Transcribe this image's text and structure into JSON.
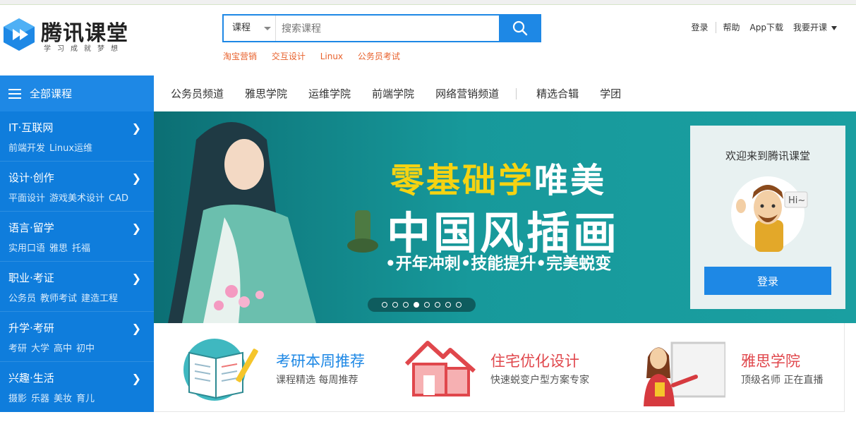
{
  "brand": {
    "name": "腾讯课堂",
    "slogan": "学习成就梦想"
  },
  "search": {
    "category": "课程",
    "placeholder": "搜索课程"
  },
  "hot_keywords": [
    "淘宝营销",
    "交互设计",
    "Linux",
    "公务员考试"
  ],
  "top_links": {
    "login": "登录",
    "help": "帮助",
    "app": "App下载",
    "teach": "我要开课"
  },
  "sidebar": {
    "header": "全部课程",
    "categories": [
      {
        "title": "IT·互联网",
        "subs": [
          "前端开发",
          "Linux运维"
        ]
      },
      {
        "title": "设计·创作",
        "subs": [
          "平面设计",
          "游戏美术设计",
          "CAD"
        ]
      },
      {
        "title": "语言·留学",
        "subs": [
          "实用口语",
          "雅思",
          "托福"
        ]
      },
      {
        "title": "职业·考证",
        "subs": [
          "公务员",
          "教师考试",
          "建造工程"
        ]
      },
      {
        "title": "升学·考研",
        "subs": [
          "考研",
          "大学",
          "高中",
          "初中"
        ]
      },
      {
        "title": "兴趣·生活",
        "subs": [
          "摄影",
          "乐器",
          "美妆",
          "育儿"
        ]
      }
    ]
  },
  "nav": [
    "公务员频道",
    "雅思学院",
    "运维学院",
    "前端学院",
    "网络营销频道",
    "精选合辑",
    "学团"
  ],
  "banner": {
    "line1_yellow": "零基础学",
    "line1_white": "唯美",
    "line2": "中国风插画",
    "line3": "•开年冲刺•技能提升•完美蜕变",
    "active_slide": 4,
    "slide_count": 8
  },
  "welcome": {
    "title": "欢迎来到腾讯课堂",
    "bubble": "Hi~",
    "login_button": "登录"
  },
  "promos": [
    {
      "title": "考研本周推荐",
      "subtitle": "课程精选 每周推荐",
      "color": "#1e88e5"
    },
    {
      "title": "住宅优化设计",
      "subtitle": "快速蜕变户型方案专家",
      "color": "#e0474c"
    },
    {
      "title": "雅思学院",
      "subtitle": "顶级名师 正在直播",
      "color": "#e0474c"
    }
  ],
  "colors": {
    "primary": "#1e88e5",
    "sidebar": "#0f7ddc",
    "banner": "#1a9a9c",
    "hot": "#e8612c"
  }
}
